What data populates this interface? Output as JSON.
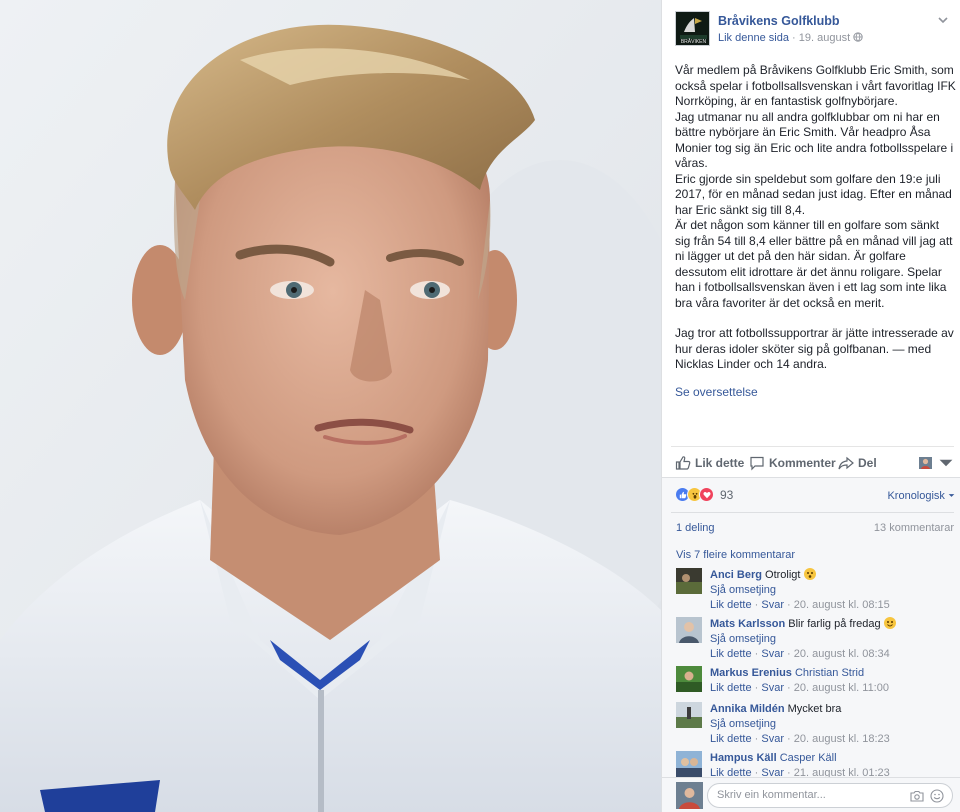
{
  "page": {
    "name": "Bråvikens Golfklubb",
    "like_page": "Lik denne sida",
    "separator": "·",
    "date": "19. august",
    "logo_text": "BRÅVIKEN"
  },
  "post": {
    "paragraphs": [
      "Vår medlem på Bråvikens Golfklubb Eric Smith, som också spelar i fotbollsallsvenskan i vårt favoritlag IFK Norrköping, är en fantastisk golfnybörjare.",
      "Jag utmanar nu all andra golfklubbar om ni har en bättre nybörjare än Eric Smith. Vår headpro Åsa Monier tog sig än Eric och lite andra fotbollsspelare i våras.",
      "Eric gjorde sin speldebut som golfare den 19:e juli 2017, för en månad sedan just idag. Efter en månad har Eric sänkt sig till 8,4.",
      "Är det någon som känner till en golfare som sänkt sig från 54 till 8,4 eller bättre på en månad vill jag att ni lägger ut det på den här sidan. Är golfare dessutom elit idrottare är det ännu roligare. Spelar han i fotbollsallsvenskan även i ett lag som inte lika bra våra favoriter är det också en merit."
    ],
    "closing": "Jag tror att fotbollssupportrar är jätte intresserade av hur deras idoler sköter sig på golfbanan. — med Nicklas Linder och 14 andra.",
    "see_translation": "Se oversettelse"
  },
  "actions": {
    "like": "Lik dette",
    "comment": "Kommenter",
    "share": "Del"
  },
  "stats": {
    "reaction_count": "93",
    "sort_label": "Kronologisk",
    "shares": "1 deling",
    "comments": "13 kommentarar",
    "more_comments": "Vis 7 fleire kommentarar"
  },
  "comments": [
    {
      "author": "Anci Berg",
      "text": "Otroligt",
      "has_emoji": true,
      "translation": "Sjå omsetjing",
      "like": "Lik dette",
      "reply": "Svar",
      "time": "20. august kl. 08:15"
    },
    {
      "author": "Mats Karlsson",
      "text": "Blir farlig på fredag",
      "has_emoji": true,
      "translation": "Sjå omsetjing",
      "like": "Lik dette",
      "reply": "Svar",
      "time": "20. august kl. 08:34"
    },
    {
      "author": "Markus Erenius",
      "tag": "Christian Strid",
      "like": "Lik dette",
      "reply": "Svar",
      "time": "20. august kl. 11:00"
    },
    {
      "author": "Annika Mildén",
      "text": "Mycket bra",
      "translation": "Sjå omsetjing",
      "like": "Lik dette",
      "reply": "Svar",
      "time": "20. august kl. 18:23"
    },
    {
      "author": "Hampus Käll",
      "tag": "Casper Käll",
      "like": "Lik dette",
      "reply": "Svar",
      "time": "21. august kl. 01:23"
    }
  ],
  "composer": {
    "placeholder": "Skriv ein kommentar..."
  },
  "colors": {
    "link": "#365899",
    "meta": "#90949c",
    "background": "#f6f7f9"
  }
}
